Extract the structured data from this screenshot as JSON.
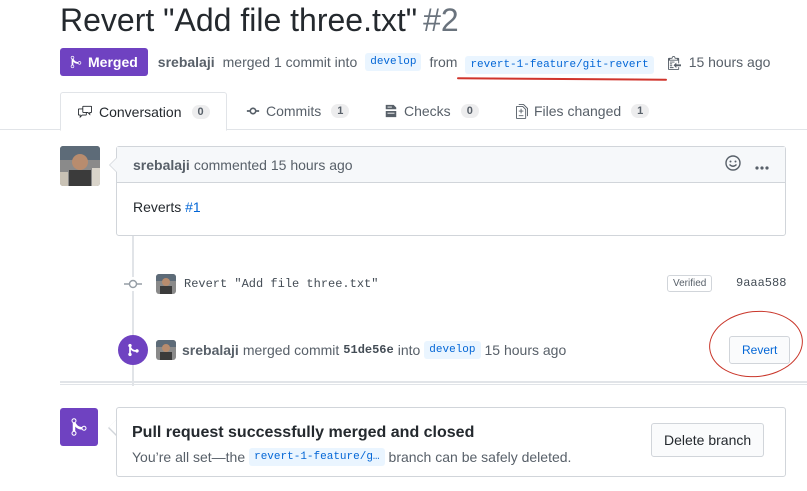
{
  "pr": {
    "title": "Revert \"Add file three.txt\"",
    "number": "#2",
    "status": "Merged",
    "author": "srebalaji",
    "merged_text": "merged 1 commit into",
    "base_branch": "develop",
    "from_text": "from",
    "head_branch": "revert-1-feature/git-revert",
    "time": "15 hours ago"
  },
  "tabs": [
    {
      "label": "Conversation",
      "count": "0"
    },
    {
      "label": "Commits",
      "count": "1"
    },
    {
      "label": "Checks",
      "count": "0"
    },
    {
      "label": "Files changed",
      "count": "1"
    }
  ],
  "comment": {
    "author": "srebalaji",
    "action": "commented 15 hours ago",
    "body_text": "Reverts",
    "body_link": "#1"
  },
  "commit": {
    "message": "Revert \"Add file three.txt\"",
    "verified": "Verified",
    "sha": "9aaa588"
  },
  "merge_event": {
    "author": "srebalaji",
    "text1": "merged commit",
    "sha": "51de56e",
    "text2": "into",
    "branch": "develop",
    "time": "15 hours ago",
    "revert_label": "Revert"
  },
  "merge_box": {
    "title": "Pull request successfully merged and closed",
    "text_before": "You’re all set—the",
    "branch": "revert-1-feature/g…",
    "text_after": "branch can be safely deleted.",
    "delete_label": "Delete branch"
  },
  "colors": {
    "merged_purple": "#6f42c1",
    "link_blue": "#0366d6",
    "annotation_red": "#d0342c"
  }
}
